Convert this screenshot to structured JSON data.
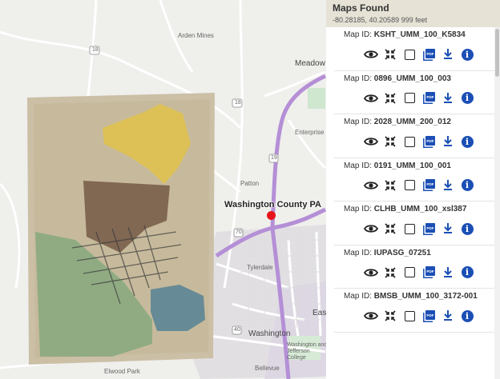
{
  "map": {
    "place_label": "Washington County PA",
    "labels": [
      {
        "id": "arden-mines",
        "text": "Arden Mines"
      },
      {
        "id": "meadow",
        "text": "Meadow"
      },
      {
        "id": "enterprise",
        "text": "Enterprise"
      },
      {
        "id": "patton",
        "text": "Patton"
      },
      {
        "id": "tylerdale",
        "text": "Tylerdale"
      },
      {
        "id": "washington",
        "text": "Washington"
      },
      {
        "id": "east-w",
        "text": "East W"
      },
      {
        "id": "elwood-park",
        "text": "Elwood Park"
      },
      {
        "id": "bellevue",
        "text": "Bellevue"
      },
      {
        "id": "wash-jeff",
        "text": "Washington and Jefferson College"
      },
      {
        "id": "route-18a",
        "text": "18"
      },
      {
        "id": "route-18b",
        "text": "18"
      },
      {
        "id": "route-19",
        "text": "19"
      },
      {
        "id": "route-70",
        "text": "70"
      },
      {
        "id": "route-40",
        "text": "40"
      }
    ]
  },
  "panel": {
    "title": "Maps Found",
    "coords": "-80.28185, 40.20589 999 feet",
    "id_prefix": "Map ID: ",
    "items": [
      {
        "map_id": "KSHT_UMM_100_K5834"
      },
      {
        "map_id": "0896_UMM_100_003"
      },
      {
        "map_id": "2028_UMM_200_012"
      },
      {
        "map_id": "0191_UMM_100_001"
      },
      {
        "map_id": "CLHB_UMM_100_xsl387"
      },
      {
        "map_id": "IUPASG_07251"
      },
      {
        "map_id": "BMSB_UMM_100_3172-001"
      }
    ],
    "actions": {
      "view_icon": "eye-icon",
      "zoom_icon": "collapse-arrows-icon",
      "select_icon": "checkbox",
      "pdf_icon": "pdf-icon",
      "pdf_text": "PDF",
      "download_icon": "download-icon",
      "info_icon": "info-icon",
      "info_text": "i"
    }
  },
  "colors": {
    "header_bg": "#e6e2d6",
    "action_blue": "#1b4fb5",
    "marker_red": "#e8141b",
    "highway_purple": "#b48fd6"
  }
}
